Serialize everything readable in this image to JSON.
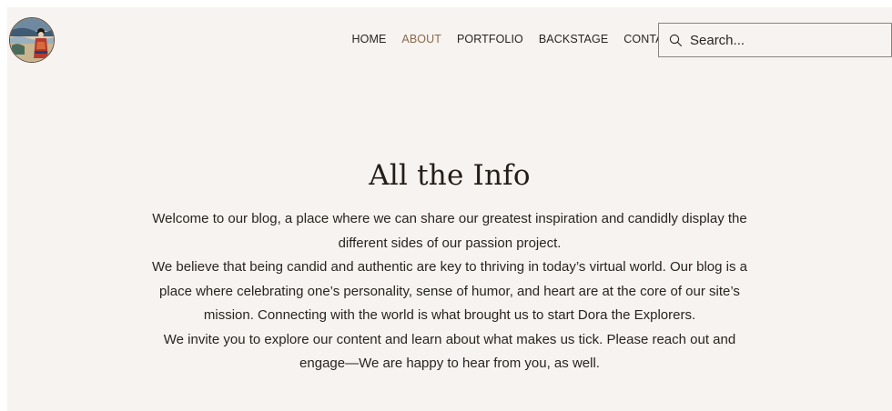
{
  "header": {
    "logo_icon": "circular-landscape-portrait-logo",
    "nav": {
      "items": [
        {
          "label": "HOME"
        },
        {
          "label": "ABOUT"
        },
        {
          "label": "PORTFOLIO"
        },
        {
          "label": "BACKSTAGE"
        },
        {
          "label": "CONTACT"
        }
      ],
      "active": "ABOUT"
    },
    "search": {
      "placeholder": "Search...",
      "icon": "search-icon"
    }
  },
  "main": {
    "title": "All the Info",
    "paragraphs": [
      "Welcome to our blog, a place where we can share our greatest inspiration and candidly display the different sides of our passion project.",
      "We believe that being candid and authentic are key to thriving in today’s virtual world. Our blog is a place where celebrating one’s personality, sense of humor, and heart are at the core of our site’s mission. Connecting with the world is what brought us to start Dora the Explorers.",
      "We invite you to explore our content and learn about what makes us tick. Please reach out and engage—We are happy to hear from you, as well."
    ]
  },
  "colors": {
    "background": "#f6f3f0",
    "text": "#2a2420",
    "nav_active": "#8a6a4e",
    "search_border": "#8a8480"
  }
}
